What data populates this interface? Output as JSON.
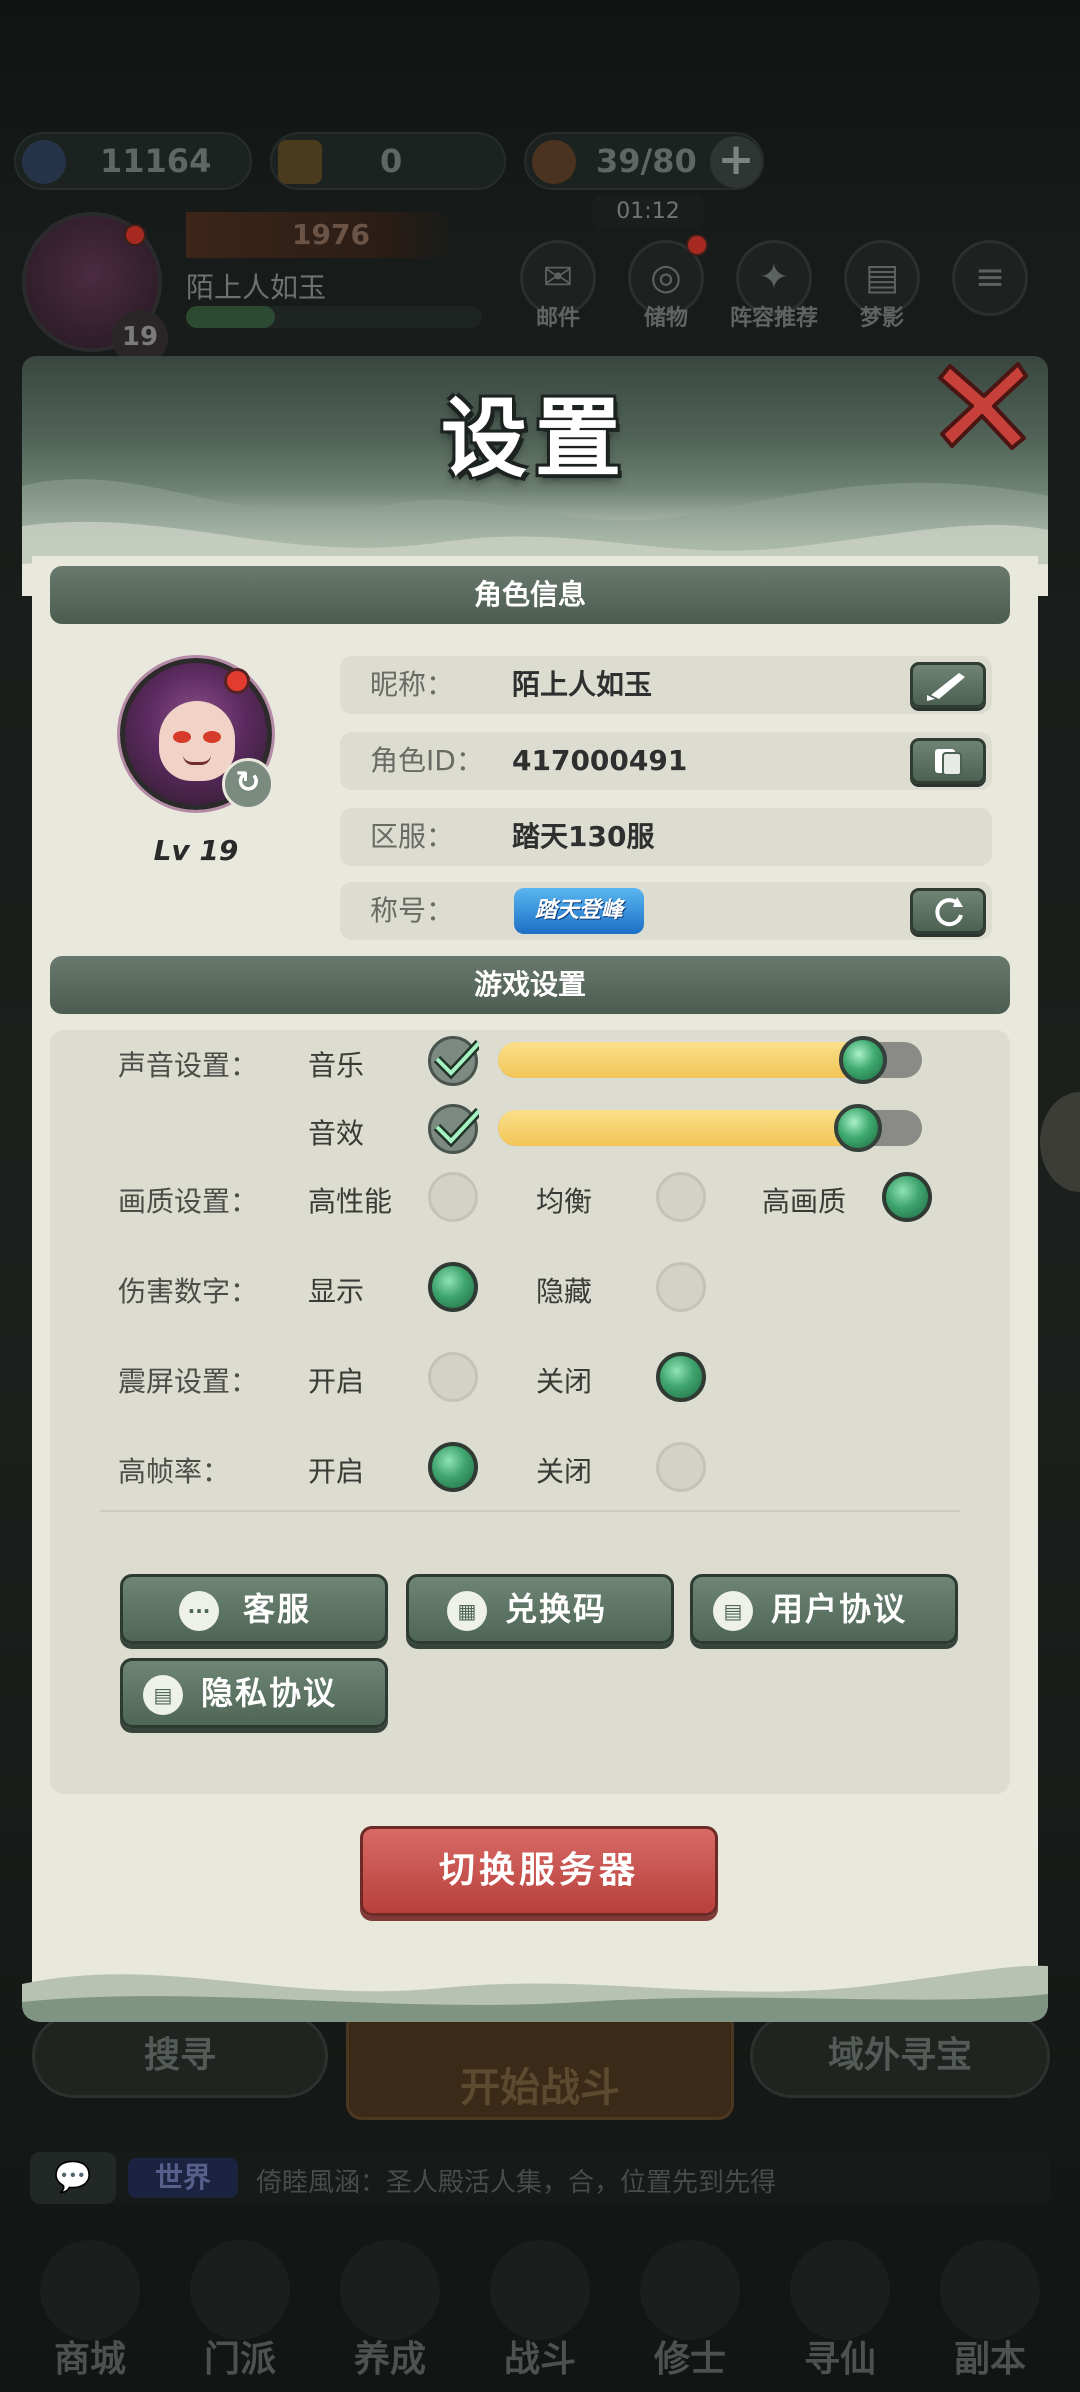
{
  "background": {
    "resources": [
      {
        "name": "currency",
        "value": "11164"
      },
      {
        "name": "ticket",
        "value": "0"
      },
      {
        "name": "stamina",
        "value": "39/80"
      }
    ],
    "timer": "01:12",
    "player": {
      "power": "1976",
      "name": "陌上人如玉",
      "level": "19"
    },
    "top_buttons": [
      "邮件",
      "储物",
      "阵容推荐",
      "梦影"
    ],
    "bottom_buttons": {
      "left": "搜寻",
      "center": "开始战斗",
      "right": "域外寻宝"
    },
    "chat": {
      "channel": "世界",
      "message": "倚睦風涵：圣人殿活人集，合，位置先到先得"
    },
    "nav": [
      "商城",
      "门派",
      "养成",
      "战斗",
      "修士",
      "寻仙",
      "副本"
    ]
  },
  "modal": {
    "title": "设置",
    "close_icon": "close-x-icon",
    "role_section": {
      "header": "角色信息",
      "level_label": "Lv 19",
      "rows": [
        {
          "label": "昵称：",
          "value": "陌上人如玉",
          "action_icon": "brush-icon"
        },
        {
          "label": "角色ID：",
          "value": "417000491",
          "action_icon": "copy-icon"
        },
        {
          "label": "区服：",
          "value": "踏天130服"
        },
        {
          "label": "称号：",
          "value": "踏天登峰",
          "action_icon": "refresh-icon"
        }
      ]
    },
    "game_section": {
      "header": "游戏设置",
      "sound": {
        "label": "声音设置：",
        "music": {
          "label": "音乐",
          "enabled": true,
          "level": 0.86
        },
        "effects": {
          "label": "音效",
          "enabled": true,
          "level": 0.85
        }
      },
      "quality": {
        "label": "画质设置：",
        "options": [
          "高性能",
          "均衡",
          "高画质"
        ],
        "selected": "高画质"
      },
      "damage_numbers": {
        "label": "伤害数字：",
        "options": [
          "显示",
          "隐藏"
        ],
        "selected": "显示"
      },
      "screen_shake": {
        "label": "震屏设置：",
        "options": [
          "开启",
          "关闭"
        ],
        "selected": "关闭"
      },
      "high_fps": {
        "label": "高帧率：",
        "options": [
          "开启",
          "关闭"
        ],
        "selected": "开启"
      }
    },
    "buttons": {
      "customer_service": "客服",
      "redeem_code": "兑换码",
      "user_agreement": "用户协议",
      "privacy_policy": "隐私协议",
      "switch_server": "切换服务器"
    }
  }
}
